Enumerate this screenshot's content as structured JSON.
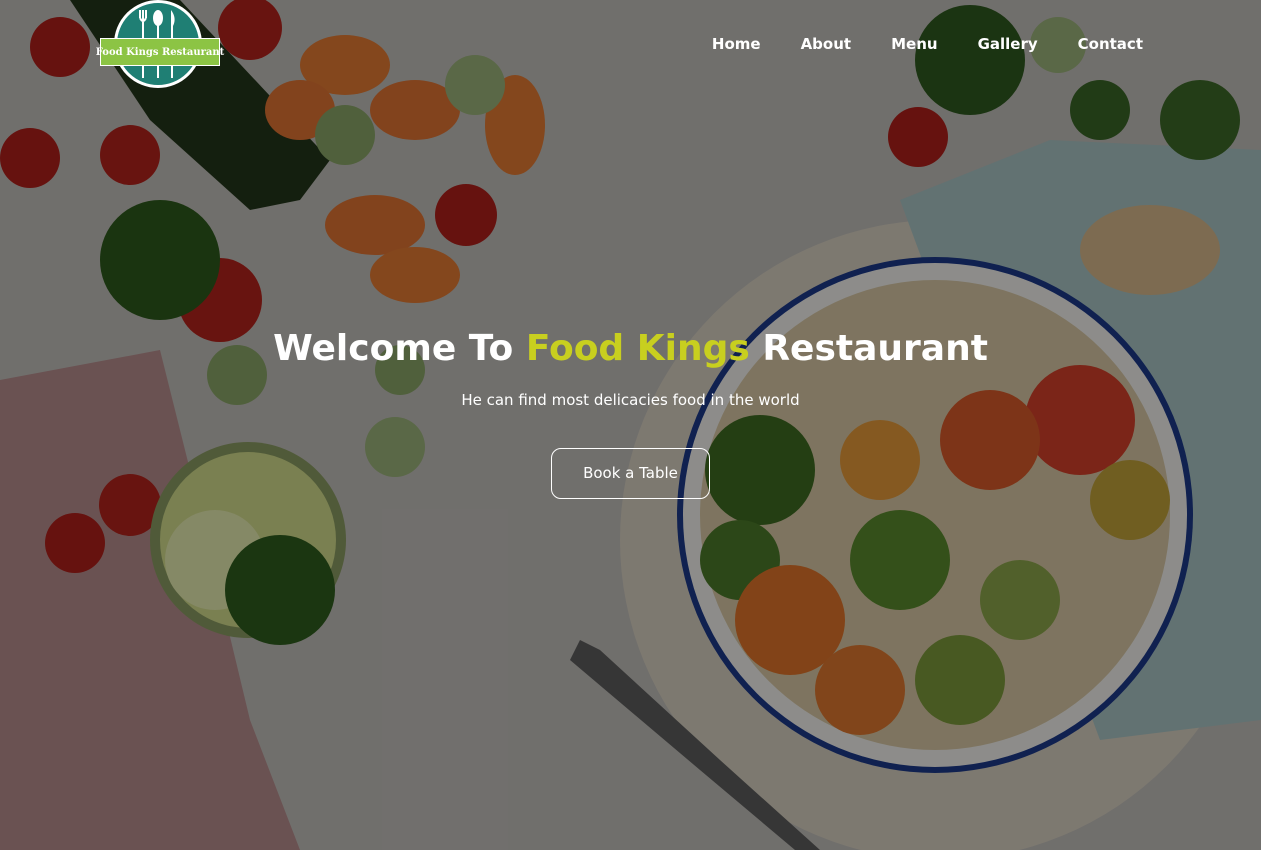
{
  "logo": {
    "text": "Food Kings Restaurant",
    "icon": "utensils-icon",
    "colors": {
      "circle": "#1f7f74",
      "banner": "#8cc444"
    }
  },
  "nav": {
    "items": [
      "Home",
      "About",
      "Menu",
      "Gallery",
      "Contact"
    ]
  },
  "hero": {
    "title_part1": "Welcome To ",
    "title_accent": "Food Kings",
    "title_part2": " Restaurant",
    "subtitle": "He can find most delicacies food in the world",
    "button_label": "Book a Table"
  },
  "colors": {
    "accent": "#c8cf1f",
    "text": "#ffffff"
  }
}
